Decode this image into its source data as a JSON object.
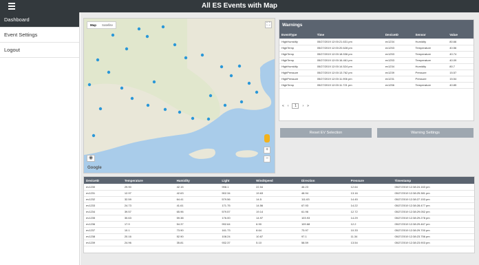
{
  "header": {
    "title": "All ES Events with Map",
    "menu_icon": "hamburger-menu-icon"
  },
  "sidebar": {
    "items": [
      {
        "label": "Dashboard"
      },
      {
        "label": "Event Settings"
      },
      {
        "label": "Logout"
      }
    ]
  },
  "map": {
    "tabs": [
      {
        "label": "Map"
      },
      {
        "label": "Satellite"
      }
    ],
    "fullscreen_icon": "fullscreen-icon",
    "zoom_in": "+",
    "zoom_out": "−",
    "google": "Google",
    "camera_icon": "camera-icon",
    "pegman_icon": "pegman-icon",
    "pin_color": "#2a97d8",
    "land_color": "#e9e7d8",
    "water_color": "#a9ccea"
  },
  "warnings": {
    "title": "Warnings",
    "columns": [
      "EventType",
      "Time",
      "DeviceID",
      "Sensor",
      "Value"
    ],
    "rows": [
      [
        "HighHumidity",
        "05/27/2019 12:00:21.631 pm",
        "ev1234",
        "Humidity",
        "80.66"
      ],
      [
        "HighTemp",
        "05/27/2019 12:00:20.628 pm",
        "ev1253",
        "Temperature",
        "40.56"
      ],
      [
        "HighTemp",
        "05/27/2019 12:00:18.536 pm",
        "ev1253",
        "Temperature",
        "40.74"
      ],
      [
        "HighTemp",
        "05/27/2019 12:00:16.461 pm",
        "ev1253",
        "Temperature",
        "40.09"
      ],
      [
        "HighHumidity",
        "05/27/2019 12:00:14.524 pm",
        "ev1234",
        "Humidity",
        "80.7"
      ],
      [
        "HighPressure",
        "05/27/2019 12:00:13.762 pm",
        "ev1239",
        "Pressure",
        "15.57"
      ],
      [
        "HighPressure",
        "05/27/2019 12:00:11.906 pm",
        "ev1231",
        "Pressure",
        "15.54"
      ],
      [
        "HighTemp",
        "05/27/2019 12:00:11.721 pm",
        "ev1256",
        "Temperature",
        "40.85"
      ]
    ],
    "pager": {
      "first": "«",
      "prev": "‹",
      "page": "1",
      "next": "›",
      "last": "»"
    }
  },
  "buttons": {
    "reset": "Reset EV Selection",
    "warning_settings": "Warning Settings"
  },
  "events": {
    "columns": [
      "DeviceID",
      "Temperature",
      "Humidity",
      "Light",
      "WindSpeed",
      "Direction",
      "Pressure",
      "Timestamp"
    ],
    "rows": [
      [
        "ev1230",
        "29.90",
        "42.15",
        "998.1",
        "22.54",
        "46.23",
        "12.64",
        "05/27/2019 12:38:24.163 pm"
      ],
      [
        "ev1231",
        "12.97",
        "42.63",
        "902.34",
        "19.63",
        "48.94",
        "13.16",
        "05/27/2019 12:38:25.381 pm"
      ],
      [
        "ev1232",
        "32.59",
        "64.41",
        "579.56",
        "14.5",
        "111.63",
        "14.45",
        "05/27/2019 12:38:27.153 pm"
      ],
      [
        "ev1233",
        "24.73",
        "41.61",
        "171.75",
        "14.56",
        "67.93",
        "14.22",
        "05/27/2019 12:38:28.477 pm"
      ],
      [
        "ev1234",
        "39.57",
        "65.96",
        "579.57",
        "19.14",
        "61.96",
        "12.72",
        "05/27/2019 12:38:29.052 pm"
      ],
      [
        "ev1235",
        "30.63",
        "59.38",
        "176.00",
        "14.97",
        "103.93",
        "14.29",
        "05/27/2019 12:38:29.278 pm"
      ],
      [
        "ev1236",
        "17.9",
        "54.37",
        "992.64",
        "6.90",
        "109.68",
        "12.2",
        "05/27/2019 12:38:29.467 pm"
      ],
      [
        "ev1237",
        "10.1",
        "73.90",
        "161.73",
        "8.64",
        "73.97",
        "10.33",
        "05/27/2019 12:38:29.700 pm"
      ],
      [
        "ev1238",
        "20.16",
        "52.90",
        "108.24",
        "10.67",
        "97.1",
        "11.34",
        "05/27/2019 12:38:23.756 pm"
      ],
      [
        "ev1239",
        "24.96",
        "35.81",
        "932.37",
        "5.10",
        "58.59",
        "13.54",
        "05/27/2019 12:38:23.903 pm"
      ]
    ]
  }
}
